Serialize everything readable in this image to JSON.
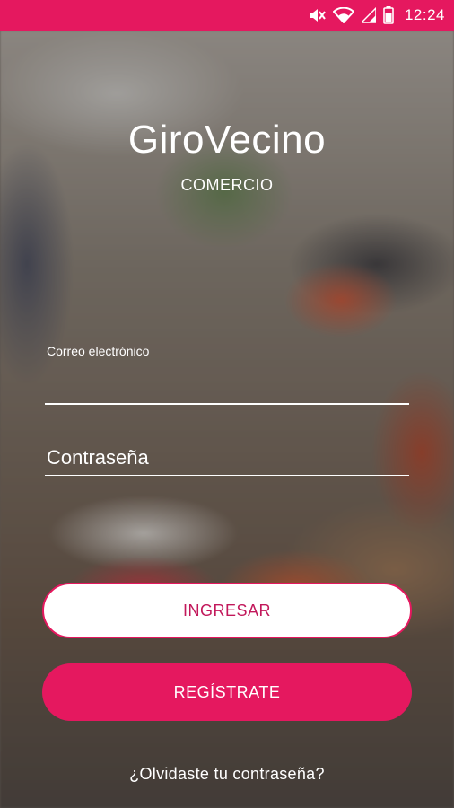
{
  "status_bar": {
    "time": "12:24",
    "icons": [
      "mute-icon",
      "wifi-icon",
      "signal-icon",
      "battery-icon"
    ],
    "color": "#e5185f"
  },
  "brand": {
    "title": "GiroVecino",
    "subtitle": "COMERCIO"
  },
  "login_form": {
    "email_label": "Correo electrónico",
    "email_value": "",
    "password_placeholder": "Contraseña",
    "login_button": "INGRESAR",
    "register_button": "REGÍSTRATE",
    "forgot_link": "¿Olvidaste tu contraseña?"
  },
  "colors": {
    "accent": "#e5185f",
    "login_text": "#c2185b",
    "text": "#ffffff"
  }
}
